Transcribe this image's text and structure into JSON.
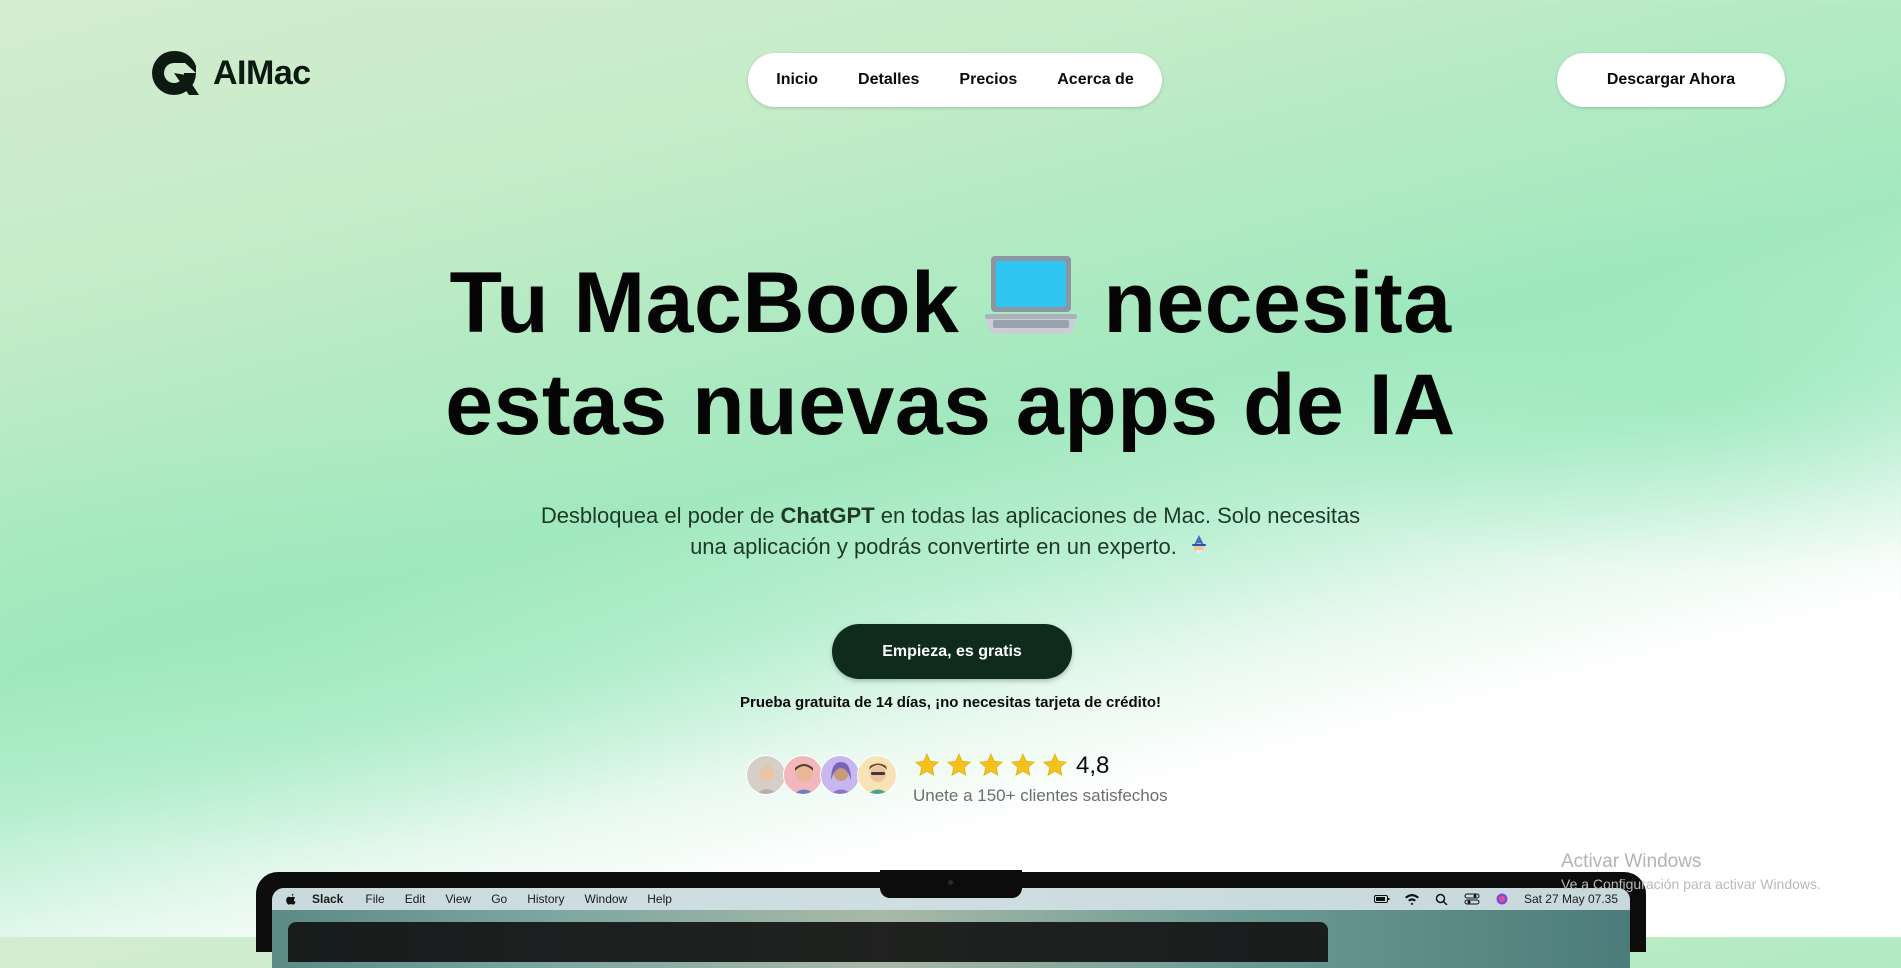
{
  "brand": {
    "name": "AIMac"
  },
  "nav": {
    "items": [
      "Inicio",
      "Detalles",
      "Precios",
      "Acerca de"
    ]
  },
  "header": {
    "download_label": "Descargar Ahora"
  },
  "hero": {
    "title_line1_before": "Tu MacBook",
    "title_line1_emoji": "laptop-emoji",
    "title_line1_after": "necesita",
    "title_line2": "estas nuevas apps de IA",
    "subtitle_part1": "Desbloquea el poder de ",
    "subtitle_bold": "ChatGPT",
    "subtitle_part2": " en todas las aplicaciones de Mac. Solo necesitas",
    "subtitle_line2": "una aplicación y podrás convertirte en un experto.",
    "subtitle_emoji": "wizard-emoji",
    "cta_label": "Empieza, es gratis",
    "trial_text": "Prueba gratuita de 14 días, ¡no necesitas tarjeta de crédito!"
  },
  "social_proof": {
    "avatar_count": 4,
    "avatar_colors": [
      "#d6cfc7",
      "#f3b6bd",
      "#c7b7ee",
      "#f7e3b5"
    ],
    "stars": 5,
    "star_color": "#f5c21b",
    "rating": "4,8",
    "customers_text": "Unete a 150+ clientes satisfechos"
  },
  "mac_preview": {
    "app_name": "Slack",
    "menu_items": [
      "File",
      "Edit",
      "View",
      "Go",
      "History",
      "Window",
      "Help"
    ],
    "clock": "Sat 27 May 07.35",
    "status_icons": [
      "battery-icon",
      "wifi-icon",
      "search-icon",
      "control-center-icon",
      "siri-icon"
    ]
  },
  "watermark": {
    "title": "Activar Windows",
    "subtitle": "Ve a Configuración para activar Windows."
  },
  "colors": {
    "cta_dark": "#0f2b1c",
    "background_green": "#a2e8bf"
  }
}
